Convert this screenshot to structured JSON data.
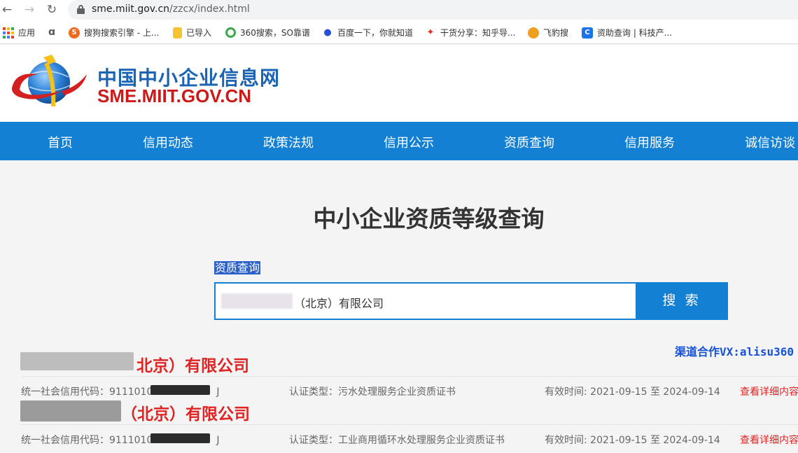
{
  "browser": {
    "url_host": "sme.miit.gov.cn",
    "url_path": "/zzcx/index.html",
    "bookmarks": [
      {
        "label": "应用",
        "icon": "apps-grid-icon",
        "color": "#e94235"
      },
      {
        "label": "",
        "icon": "a-logo-icon",
        "color": "#555555"
      },
      {
        "label": "搜狗搜索引擎 - 上...",
        "icon": "sogou-icon",
        "color": "#f26b1d"
      },
      {
        "label": "已导入",
        "icon": "folder-icon",
        "color": "#f4c430"
      },
      {
        "label": "360搜索，SO靠谱",
        "icon": "360-search-icon",
        "color": "#3aa74a"
      },
      {
        "label": "百度一下，你就知道",
        "icon": "baidu-paw-icon",
        "color": "#2a4fd6"
      },
      {
        "label": "干货分享：知乎导...",
        "icon": "zhihu-share-icon",
        "color": "#d93025"
      },
      {
        "label": "飞豹搜",
        "icon": "leopard-search-icon",
        "color": "#f0a020"
      },
      {
        "label": "资助查询 | 科技产...",
        "icon": "support-query-icon",
        "color": "#1a73e8"
      }
    ]
  },
  "site": {
    "name": "中国中小企业信息网",
    "domain": "SME.MIIT.GOV.CN",
    "brand_blue": "#1380d3",
    "brand_red": "#cc1a1a"
  },
  "nav": [
    "首页",
    "信用动态",
    "政策法规",
    "信用公示",
    "资质查询",
    "信用服务",
    "诚信访谈"
  ],
  "main": {
    "title": "中小企业资质等级查询",
    "search_label": "资质查询",
    "search_value": "（北京）有限公司",
    "search_button": "搜 索",
    "cooperation": "渠道合作VX:alisu360"
  },
  "results": [
    {
      "company_name": "北京）有限公司",
      "credit_code": "统一社会信用代码：9111010",
      "credit_code_tail": "J",
      "cert_type": "认证类型：污水处理服务企业资质证书",
      "validity": "有效时间: 2021-09-15 至 2024-09-14",
      "detail_link": "查看详细内容"
    },
    {
      "company_name": "（北京）有限公司",
      "credit_code": "统一社会信用代码：9111010",
      "credit_code_tail": "J",
      "cert_type": "认证类型：工业商用循环水处理服务企业资质证书",
      "validity": "有效时间: 2021-09-15 至 2024-09-14",
      "detail_link": "查看详细内容"
    }
  ]
}
